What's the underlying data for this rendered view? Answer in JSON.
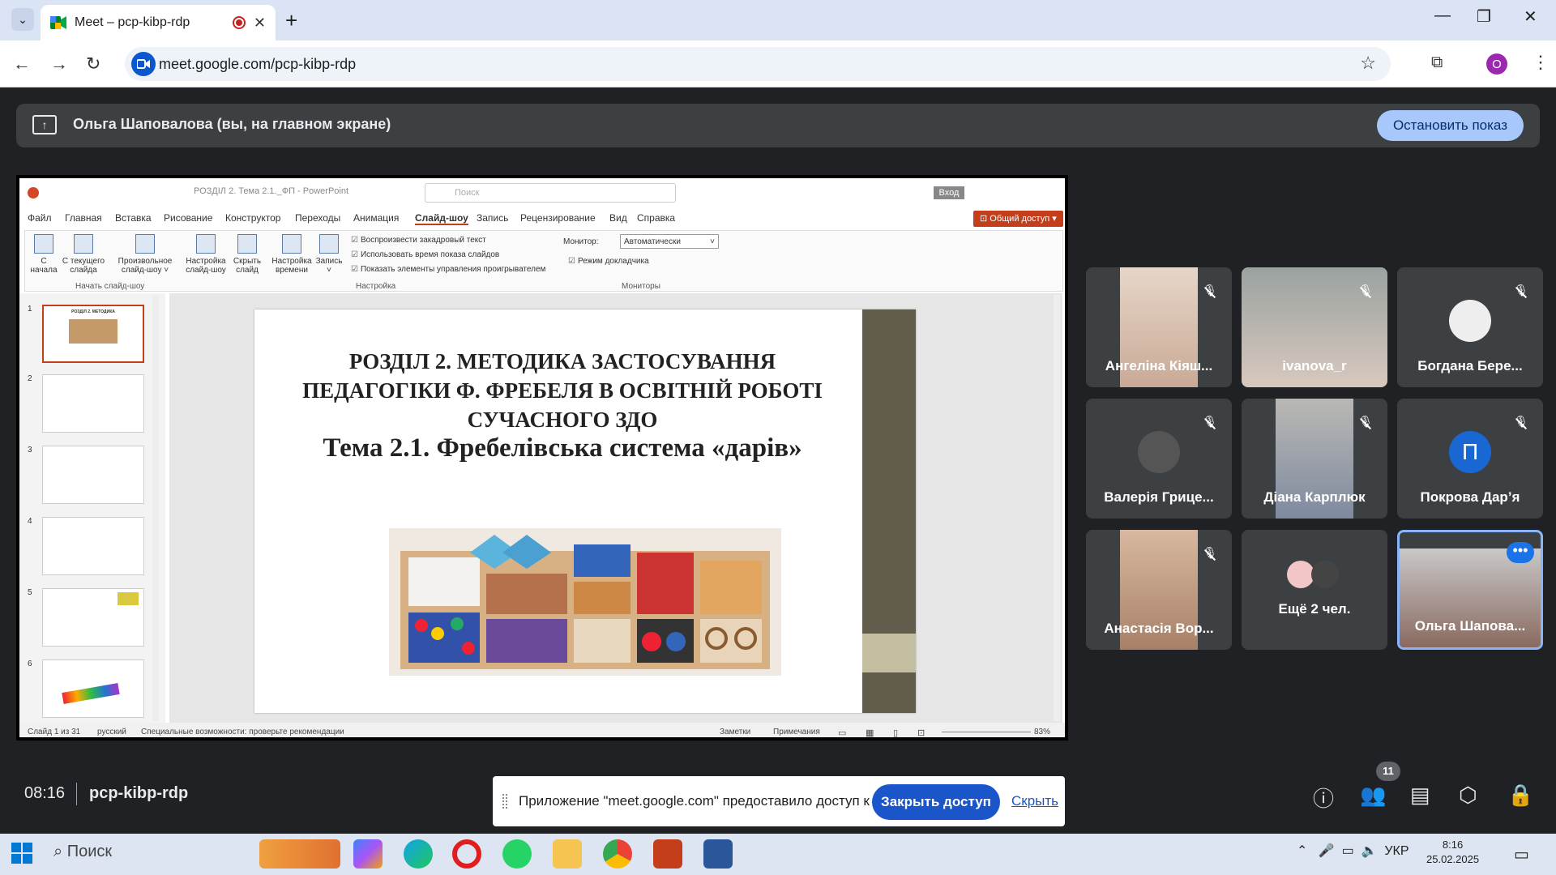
{
  "browser": {
    "tab_title": "Meet – pcp-kibp-rdp",
    "url": "meet.google.com/pcp-kibp-rdp",
    "profile_initial": "O"
  },
  "meet": {
    "presenter_text": "Ольга Шаповалова (вы, на главном экране)",
    "stop_button": "Остановить показ",
    "time": "08:16",
    "meeting_code": "pcp-kibp-rdp",
    "participants_count": "11"
  },
  "ppt": {
    "title": "РОЗДІЛ 2. Тема 2.1._ФП  -  PowerPoint",
    "search_placeholder": "Поиск",
    "login": "Вход",
    "share": "⊡ Общий доступ ▾",
    "menu": [
      "Файл",
      "Главная",
      "Вставка",
      "Рисование",
      "Конструктор",
      "Переходы",
      "Анимация",
      "Слайд-шоу",
      "Запись",
      "Рецензирование",
      "Вид",
      "Справка"
    ],
    "ribbon": {
      "from_start": "С начала",
      "from_current": "С текущего слайда",
      "custom": "Произвольное слайд-шоу ˅",
      "setup": "Настройка слайд-шоу",
      "hide": "Скрыть слайд",
      "timing": "Настройка времени",
      "record": "Запись ˅",
      "chk1": "Воспроизвести закадровый текст",
      "chk2": "Использовать время показа слайдов",
      "chk3": "Показать элементы управления проигрывателем",
      "monitor_label": "Монитор:",
      "monitor_value": "Автоматически",
      "presenter_mode": "Режим докладчика",
      "group_start": "Начать слайд-шоу",
      "group_setup": "Настройка",
      "group_monitors": "Мониторы"
    },
    "thumb_numbers": [
      "1",
      "2",
      "3",
      "4",
      "5",
      "6"
    ],
    "slide_title": "РОЗДІЛ 2. МЕТОДИКА ЗАСТОСУВАННЯ ПЕДАГОГІКИ Ф. ФРЕБЕЛЯ В ОСВІТНІЙ РОБОТІ СУЧАСНОГО ЗДО",
    "slide_subtitle": "Тема 2.1. Фребелівська система «дарів»",
    "status": {
      "slide": "Слайд 1 из 31",
      "lang": "русский",
      "access": "Специальные возможности: проверьте рекомендации",
      "notes": "Заметки",
      "comments": "Примечания",
      "zoom": "83%"
    }
  },
  "participants": [
    {
      "name": "Ангеліна Кіяш..."
    },
    {
      "name": "ivanova_r"
    },
    {
      "name": "Богдана Бере..."
    },
    {
      "name": "Валерія Грице..."
    },
    {
      "name": "Діана Карплюк"
    },
    {
      "name": "Покрова Дар’я",
      "initial": "П"
    },
    {
      "name": "Анастасія Вор..."
    },
    {
      "name": "Ещё 2 чел."
    },
    {
      "name": "Ольга Шапова..."
    }
  ],
  "notification": {
    "text": "Приложение \"meet.google.com\" предоставило доступ к окну.",
    "close_button": "Закрыть доступ",
    "hide_link": "Скрыть"
  },
  "taskbar": {
    "search": "Поиск",
    "lang": "УКР",
    "time": "8:16",
    "date": "25.02.2025"
  },
  "colors": {
    "meet_bg": "#202124",
    "accent": "#a8c7fa",
    "ppt_accent": "#c43e1c"
  }
}
